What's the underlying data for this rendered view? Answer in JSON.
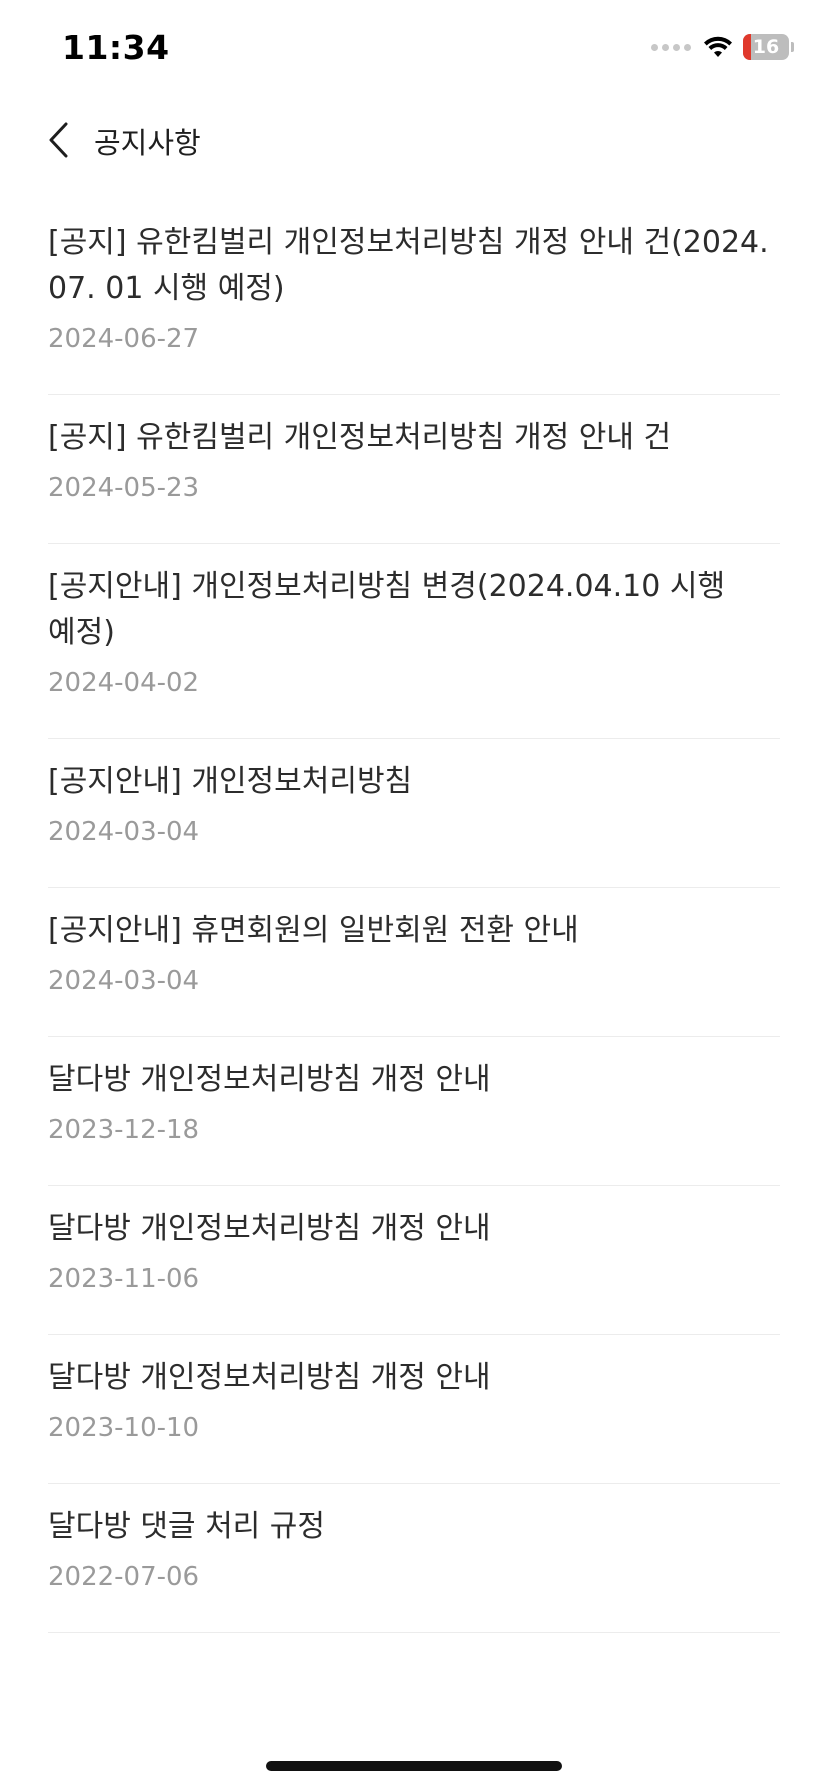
{
  "status_bar": {
    "time": "11:34",
    "battery_level": "16",
    "icons": [
      "signal-icon",
      "wifi-icon",
      "battery-icon"
    ]
  },
  "header": {
    "title": "공지사항",
    "back_icon": "chevron-left-icon"
  },
  "notices": [
    {
      "title": "[공지] 유한킴벌리 개인정보처리방침 개정 안내 건(2024. 07. 01 시행 예정)",
      "date": "2024-06-27"
    },
    {
      "title": "[공지] 유한킴벌리 개인정보처리방침 개정 안내 건",
      "date": "2024-05-23"
    },
    {
      "title": "[공지안내] 개인정보처리방침 변경(2024.04.10 시행 예정)",
      "date": "2024-04-02"
    },
    {
      "title": "[공지안내] 개인정보처리방침",
      "date": "2024-03-04"
    },
    {
      "title": "[공지안내] 휴면회원의 일반회원 전환 안내",
      "date": "2024-03-04"
    },
    {
      "title": "달다방 개인정보처리방침 개정 안내",
      "date": "2023-12-18"
    },
    {
      "title": "달다방 개인정보처리방침 개정 안내",
      "date": "2023-11-06"
    },
    {
      "title": "달다방 개인정보처리방침 개정 안내",
      "date": "2023-10-10"
    },
    {
      "title": "달다방 댓글 처리 규정",
      "date": "2022-07-06"
    }
  ],
  "colors": {
    "title_text": "#2c2c2c",
    "date_text": "#9a9a9a",
    "divider": "#ececec",
    "battery_low": "#e0392c"
  }
}
